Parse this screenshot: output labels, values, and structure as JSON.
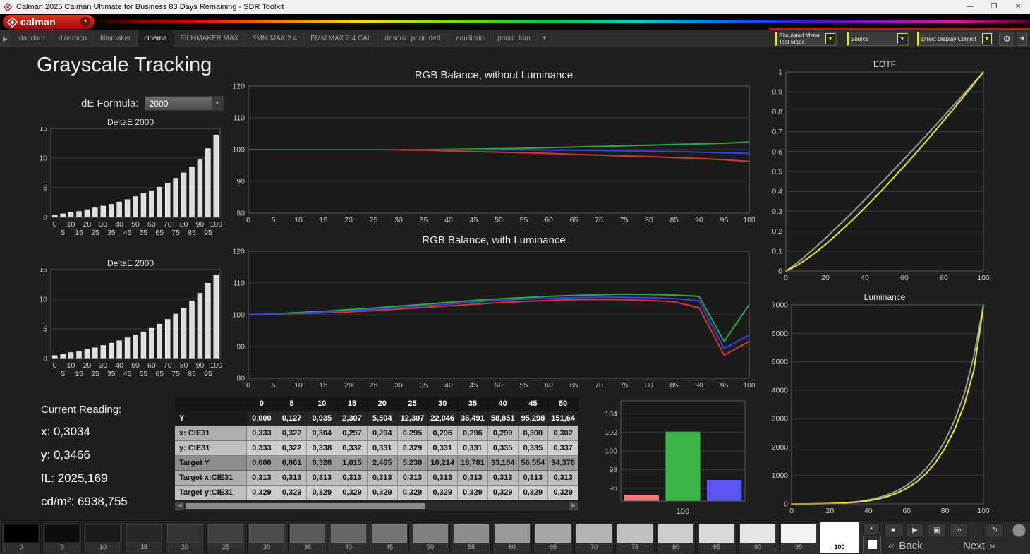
{
  "title_bar": {
    "title": "Calman 2025 Calman Ultimate for Business 83 Days Remaining  - SDR Toolkit",
    "minimize": "—",
    "maximize": "❐",
    "close": "✕"
  },
  "logo_bar": {
    "logo_text": "calman"
  },
  "tab_bar": {
    "tabs": [
      {
        "label": "standard",
        "active": false
      },
      {
        "label": "dinamico",
        "active": false
      },
      {
        "label": "filmmaker",
        "active": false
      },
      {
        "label": "cinema",
        "active": true
      },
      {
        "label": "FILMMAKER MAX",
        "active": false
      },
      {
        "label": "FMM MAX 2.4",
        "active": false
      },
      {
        "label": "FMM MAX 2.4 CAL",
        "active": false
      },
      {
        "label": "descriz. prior. dett.",
        "active": false
      },
      {
        "label": "equilibrio",
        "active": false
      },
      {
        "label": "priorit. lum",
        "active": false
      }
    ],
    "add_tab": "+",
    "meter_dropdown": {
      "line1": "Simulated Meter",
      "line2": "Test Mode"
    },
    "source_dropdown": {
      "line1": "Source",
      "line2": ""
    },
    "display_dropdown": {
      "line1": "Direct Display Control",
      "line2": ""
    },
    "accent_color": "#e8e832"
  },
  "page": {
    "title": "Grayscale Tracking",
    "de_formula_label": "dE Formula:",
    "de_formula_value": "2000"
  },
  "current_reading": {
    "heading": "Current Reading:",
    "x": "x: 0,3034",
    "y": "y: 0,3466",
    "fl": "fL: 2025,169",
    "cdm2": "cd/m²: 6938,755"
  },
  "table": {
    "headers": [
      "",
      "0",
      "5",
      "10",
      "15",
      "20",
      "25",
      "30",
      "35",
      "40",
      "45",
      "50"
    ],
    "rows": [
      {
        "label": "Y",
        "style": "dark",
        "values": [
          "0,000",
          "0,127",
          "0,935",
          "2,307",
          "5,504",
          "12,307",
          "22,046",
          "36,491",
          "58,851",
          "95,298",
          "151,64"
        ]
      },
      {
        "label": "x: CIE31",
        "style": "light-a",
        "values": [
          "0,333",
          "0,322",
          "0,304",
          "0,297",
          "0,294",
          "0,295",
          "0,296",
          "0,296",
          "0,299",
          "0,300",
          "0,302"
        ]
      },
      {
        "label": "y: CIE31",
        "style": "light-b",
        "values": [
          "0,333",
          "0,322",
          "0,338",
          "0,332",
          "0,331",
          "0,329",
          "0,331",
          "0,331",
          "0,335",
          "0,335",
          "0,337"
        ]
      },
      {
        "label": "Target Y",
        "style": "mid",
        "values": [
          "0,000",
          "0,061",
          "0,328",
          "1,015",
          "2,465",
          "5,238",
          "10,214",
          "18,781",
          "33,104",
          "56,554",
          "94,378"
        ]
      },
      {
        "label": "Target x:CIE31",
        "style": "light-a",
        "values": [
          "0,313",
          "0,313",
          "0,313",
          "0,313",
          "0,313",
          "0,313",
          "0,313",
          "0,313",
          "0,313",
          "0,313",
          "0,313"
        ]
      },
      {
        "label": "Target y:CIE31",
        "style": "light-b",
        "values": [
          "0,329",
          "0,329",
          "0,329",
          "0,329",
          "0,329",
          "0,329",
          "0,329",
          "0,329",
          "0,329",
          "0,329",
          "0,329"
        ]
      }
    ]
  },
  "chart_data": [
    {
      "id": "deltae1",
      "type": "bar",
      "title": "DeltaE 2000",
      "x": [
        0,
        5,
        10,
        15,
        20,
        25,
        30,
        35,
        40,
        45,
        50,
        55,
        60,
        65,
        70,
        75,
        80,
        85,
        90,
        95,
        100
      ],
      "values": [
        0.4,
        0.6,
        0.8,
        1.0,
        1.3,
        1.6,
        1.9,
        2.2,
        2.6,
        3.0,
        3.5,
        4.0,
        4.5,
        5.1,
        5.8,
        6.6,
        7.5,
        8.5,
        9.7,
        11.6,
        13.9
      ],
      "xlim": [
        -2.5,
        102.5
      ],
      "ylim": [
        0,
        15
      ],
      "yticks": [
        0,
        5,
        10,
        15
      ],
      "xticks": [
        0,
        5,
        10,
        15,
        20,
        25,
        30,
        35,
        40,
        45,
        50,
        55,
        60,
        65,
        70,
        75,
        80,
        85,
        90,
        95,
        100
      ],
      "two_row_xticks": true,
      "bar_color": "#dedede"
    },
    {
      "id": "deltae2",
      "type": "bar",
      "title": "DeltaE 2000",
      "x": [
        0,
        5,
        10,
        15,
        20,
        25,
        30,
        35,
        40,
        45,
        50,
        55,
        60,
        65,
        70,
        75,
        80,
        85,
        90,
        95,
        100
      ],
      "values": [
        0.5,
        0.7,
        1.0,
        1.2,
        1.5,
        1.8,
        2.2,
        2.6,
        3.0,
        3.5,
        4.0,
        4.5,
        5.1,
        5.8,
        6.6,
        7.5,
        8.5,
        9.6,
        11.0,
        12.7,
        14.1
      ],
      "xlim": [
        -2.5,
        102.5
      ],
      "ylim": [
        0,
        15
      ],
      "yticks": [
        0,
        5,
        10,
        15
      ],
      "xticks": [
        0,
        5,
        10,
        15,
        20,
        25,
        30,
        35,
        40,
        45,
        50,
        55,
        60,
        65,
        70,
        75,
        80,
        85,
        90,
        95,
        100
      ],
      "two_row_xticks": true,
      "bar_color": "#dedede"
    },
    {
      "id": "rgb_no_lum",
      "type": "line",
      "title": "RGB Balance, without Luminance",
      "x": [
        0,
        5,
        10,
        15,
        20,
        25,
        30,
        35,
        40,
        45,
        50,
        55,
        60,
        65,
        70,
        75,
        80,
        85,
        90,
        95,
        100
      ],
      "xlim": [
        0,
        100
      ],
      "ylim": [
        80,
        120
      ],
      "yticks": [
        80,
        90,
        100,
        110,
        120
      ],
      "xticks": [
        0,
        5,
        10,
        15,
        20,
        25,
        30,
        35,
        40,
        45,
        50,
        55,
        60,
        65,
        70,
        75,
        80,
        85,
        90,
        95,
        100
      ],
      "series": [
        {
          "name": "Green",
          "color": "#2fa74a",
          "values": [
            100,
            100,
            100,
            100,
            100,
            100,
            100,
            100,
            100.1,
            100.2,
            100.3,
            100.4,
            100.6,
            100.8,
            101.0,
            101.2,
            101.4,
            101.6,
            101.8,
            102.0,
            102.4
          ]
        },
        {
          "name": "Red",
          "color": "#d93535",
          "values": [
            100,
            100,
            100,
            100,
            100,
            100,
            99.9,
            99.8,
            99.6,
            99.4,
            99.2,
            99.0,
            98.8,
            98.5,
            98.3,
            98.0,
            97.8,
            97.5,
            97.2,
            96.8,
            96.3
          ]
        },
        {
          "name": "Blue",
          "color": "#3545d9",
          "values": [
            100,
            100,
            100,
            100,
            100,
            100,
            100,
            100,
            100,
            100,
            99.9,
            99.9,
            99.8,
            99.8,
            99.7,
            99.6,
            99.5,
            99.4,
            99.2,
            99.0,
            98.8
          ]
        }
      ]
    },
    {
      "id": "rgb_lum",
      "type": "line",
      "title": "RGB Balance, with Luminance",
      "x": [
        0,
        5,
        10,
        15,
        20,
        25,
        30,
        35,
        40,
        45,
        50,
        55,
        60,
        65,
        70,
        75,
        80,
        85,
        90,
        95,
        100
      ],
      "xlim": [
        0,
        100
      ],
      "ylim": [
        80,
        120
      ],
      "yticks": [
        80,
        90,
        100,
        110,
        120
      ],
      "xticks": [
        0,
        5,
        10,
        15,
        20,
        25,
        30,
        35,
        40,
        45,
        50,
        55,
        60,
        65,
        70,
        75,
        80,
        85,
        90,
        95,
        100
      ],
      "series": [
        {
          "name": "Green",
          "color": "#2fa74a",
          "values": [
            100,
            100.3,
            100.7,
            101.1,
            101.6,
            102.1,
            102.7,
            103.3,
            103.9,
            104.5,
            105.0,
            105.4,
            105.8,
            106.1,
            106.3,
            106.5,
            106.4,
            106.2,
            105.8,
            91.6,
            103.2
          ]
        },
        {
          "name": "Red",
          "color": "#d93535",
          "values": [
            100,
            100.2,
            100.4,
            100.6,
            100.9,
            101.3,
            101.8,
            102.3,
            102.8,
            103.3,
            103.8,
            104.2,
            104.5,
            104.7,
            104.8,
            104.7,
            104.5,
            104.1,
            102.2,
            87.3,
            91.6
          ]
        },
        {
          "name": "Blue",
          "color": "#3545d9",
          "values": [
            100,
            100.2,
            100.5,
            100.8,
            101.2,
            101.7,
            102.2,
            102.8,
            103.4,
            104.0,
            104.5,
            104.9,
            105.2,
            105.4,
            105.5,
            105.5,
            105.4,
            105.1,
            104.4,
            89.4,
            93.6
          ]
        }
      ]
    },
    {
      "id": "rgb_100",
      "type": "bar-cat",
      "categories": [
        "Red",
        "Green",
        "Blue"
      ],
      "values": [
        95.3,
        102.1,
        96.9
      ],
      "colors": [
        "#ef7d7d",
        "#3cb549",
        "#5b55f0"
      ],
      "xlim": [
        0,
        1
      ],
      "ylim": [
        94.6,
        105.4
      ],
      "yticks": [
        96,
        98,
        100,
        102,
        104
      ],
      "xlabel": "100"
    },
    {
      "id": "eotf",
      "type": "line",
      "title": "EOTF",
      "x": [
        0,
        5,
        10,
        15,
        20,
        25,
        30,
        35,
        40,
        45,
        50,
        55,
        60,
        65,
        70,
        75,
        80,
        85,
        90,
        95,
        100
      ],
      "xlim": [
        0,
        100
      ],
      "ylim": [
        0,
        1
      ],
      "yticks": [
        0,
        0.1,
        0.2,
        0.3,
        0.4,
        0.5,
        0.6,
        0.7,
        0.8,
        0.9,
        1
      ],
      "ytick_labels": [
        "0",
        "0,1",
        "0,2",
        "0,3",
        "0,4",
        "0,5",
        "0,6",
        "0,7",
        "0,8",
        "0,9",
        "1"
      ],
      "xticks": [
        0,
        20,
        40,
        60,
        80,
        100
      ],
      "series": [
        {
          "name": "Target",
          "color": "#9a9a9a",
          "values": [
            0,
            0.035,
            0.076,
            0.119,
            0.165,
            0.212,
            0.259,
            0.308,
            0.358,
            0.409,
            0.46,
            0.512,
            0.564,
            0.617,
            0.67,
            0.724,
            0.779,
            0.834,
            0.889,
            0.944,
            1.0
          ]
        },
        {
          "name": "Measured",
          "color": "#e6e635",
          "values": [
            0,
            0.024,
            0.056,
            0.093,
            0.133,
            0.177,
            0.222,
            0.269,
            0.318,
            0.369,
            0.42,
            0.474,
            0.528,
            0.583,
            0.64,
            0.698,
            0.757,
            0.816,
            0.877,
            0.938,
            1.0
          ]
        }
      ]
    },
    {
      "id": "luminance",
      "type": "line",
      "title": "Luminance",
      "x": [
        0,
        5,
        10,
        15,
        20,
        25,
        30,
        35,
        40,
        45,
        50,
        55,
        60,
        65,
        70,
        75,
        80,
        85,
        90,
        95,
        100
      ],
      "xlim": [
        0,
        100
      ],
      "ylim": [
        0,
        7000
      ],
      "yticks": [
        0,
        1000,
        2000,
        3000,
        4000,
        5000,
        6000,
        7000
      ],
      "xticks": [
        0,
        20,
        40,
        60,
        80,
        100
      ],
      "series": [
        {
          "name": "Target",
          "color": "#9a9a9a",
          "values": [
            0,
            1,
            3,
            8,
            16,
            30,
            52,
            85,
            140,
            215,
            320,
            460,
            650,
            900,
            1230,
            1660,
            2220,
            2940,
            3870,
            5200,
            7000
          ]
        },
        {
          "name": "Measured",
          "color": "#e6e635",
          "values": [
            0,
            0,
            2,
            6,
            12,
            23,
            41,
            68,
            110,
            170,
            260,
            380,
            545,
            765,
            1060,
            1450,
            1960,
            2620,
            3480,
            4700,
            6939
          ]
        }
      ]
    }
  ],
  "bottom_bar": {
    "patch_values": [
      0,
      5,
      10,
      15,
      20,
      25,
      30,
      35,
      40,
      45,
      50,
      55,
      60,
      65,
      70,
      75,
      80,
      85,
      90,
      95,
      100
    ],
    "selected_patch": 100,
    "back_label": "Back",
    "next_label": "Next"
  }
}
